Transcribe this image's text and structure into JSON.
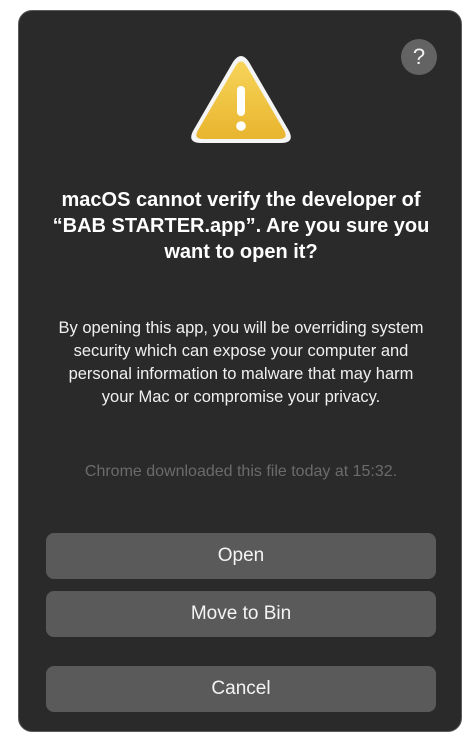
{
  "dialog": {
    "help_label": "?",
    "headline": "macOS cannot verify the developer of “BAB STARTER.app”. Are you sure you want to open it?",
    "body": "By opening this app, you will be overriding system security which can expose your computer and personal information to malware that may harm your Mac or compromise your privacy.",
    "source_note": "Chrome downloaded this file today at 15:32.",
    "icon": "warning-triangle-icon",
    "buttons": {
      "open": "Open",
      "move_to_bin": "Move to Bin",
      "cancel": "Cancel"
    }
  },
  "colors": {
    "dialog_background": "#2a2a2a",
    "button_background": "#5a5a5a",
    "warning_yellow": "#f2c743",
    "muted_text": "#6b6b6b"
  }
}
